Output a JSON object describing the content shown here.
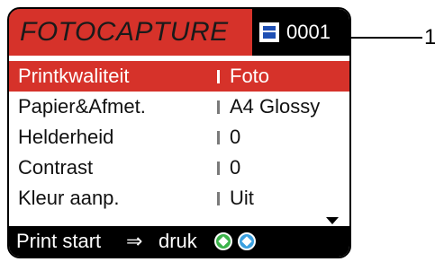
{
  "header": {
    "title": "FOTOCAPTURE",
    "counter": "0001",
    "icon": "media-card-icon"
  },
  "menu": {
    "items": [
      {
        "label": "Printkwaliteit",
        "value": "Foto",
        "selected": true
      },
      {
        "label": "Papier&Afmet.",
        "value": "A4 Glossy",
        "selected": false
      },
      {
        "label": "Helderheid",
        "value": "0",
        "selected": false
      },
      {
        "label": "Contrast",
        "value": "0",
        "selected": false
      },
      {
        "label": "Kleur aanp.",
        "value": "Uit",
        "selected": false
      }
    ]
  },
  "footer": {
    "hint": "Print start",
    "arrow": "⇒",
    "word": "druk"
  },
  "callout": {
    "number": "1"
  },
  "colors": {
    "accent": "#d6322a",
    "header_bg": "#000000",
    "green_button": "#3bb34a",
    "blue_button": "#3aa0e0"
  }
}
